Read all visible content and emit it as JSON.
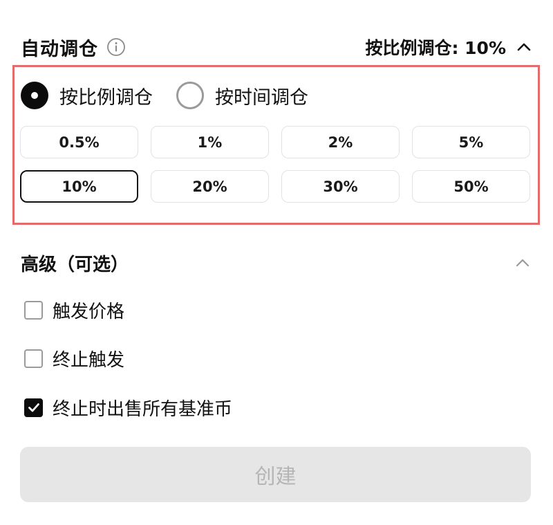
{
  "auto_rebalance": {
    "title": "自动调仓",
    "summary": "按比例调仓: 10%",
    "expanded": true
  },
  "mode_options": [
    {
      "label": "按比例调仓",
      "selected": true
    },
    {
      "label": "按时间调仓",
      "selected": false
    }
  ],
  "percent_options": [
    {
      "label": "0.5%",
      "selected": false
    },
    {
      "label": "1%",
      "selected": false
    },
    {
      "label": "2%",
      "selected": false
    },
    {
      "label": "5%",
      "selected": false
    },
    {
      "label": "10%",
      "selected": true
    },
    {
      "label": "20%",
      "selected": false
    },
    {
      "label": "30%",
      "selected": false
    },
    {
      "label": "50%",
      "selected": false
    }
  ],
  "advanced": {
    "title": "高级（可选）",
    "expanded": true
  },
  "options": [
    {
      "label": "触发价格",
      "checked": false
    },
    {
      "label": "终止触发",
      "checked": false
    },
    {
      "label": "终止时出售所有基准币",
      "checked": true
    }
  ],
  "create_button": {
    "label": "创建",
    "enabled": false
  },
  "colors": {
    "highlight_border": "#e36b6b",
    "selected_border": "#111111",
    "disabled_button_bg": "#e6e6e6",
    "disabled_button_text": "#b5b5b5"
  },
  "icons": {
    "info": "info-icon",
    "chevron": "chevron-up-icon",
    "check": "checkmark-icon"
  }
}
